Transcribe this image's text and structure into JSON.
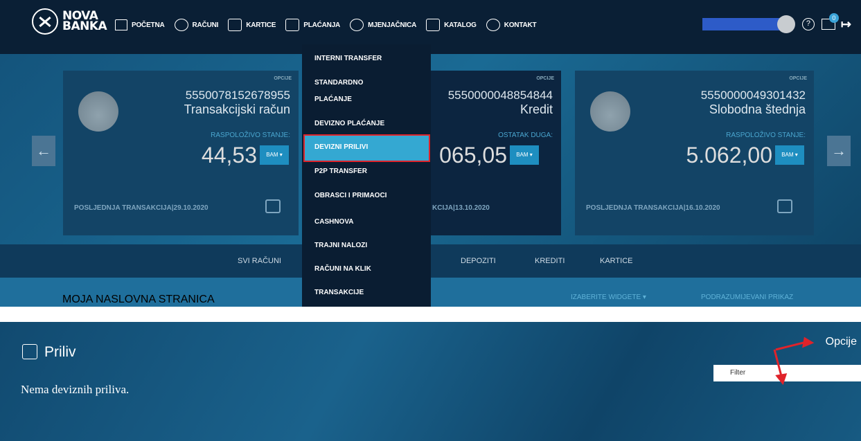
{
  "brand": {
    "line1": "NOVA",
    "line2": "BANKA"
  },
  "nav": {
    "items": [
      {
        "label": "POČETNA",
        "icon": "home-icon"
      },
      {
        "label": "RAČUNI",
        "icon": "accounts-icon"
      },
      {
        "label": "KARTICE",
        "icon": "card-icon"
      },
      {
        "label": "PLAĆANJA",
        "icon": "payments-icon"
      },
      {
        "label": "MJENJAČNICA",
        "icon": "exchange-icon"
      },
      {
        "label": "KATALOG",
        "icon": "catalog-icon"
      },
      {
        "label": "KONTAKT",
        "icon": "chat-icon"
      }
    ],
    "help": "?",
    "mail_badge": "0"
  },
  "dropdown": {
    "items": [
      "INTERNI TRANSFER",
      "STANDARDNO",
      "PLAĆANJE",
      "DEVIZNO PLAĆANJE",
      "DEVIZNI PRILIVI",
      "P2P TRANSFER",
      "OBRASCI I PRIMAOCI",
      "CASHNOVA",
      "TRAJNI NALOZI",
      "RAČUNI NA KLIK",
      "TRANSAKCIJE"
    ],
    "selected": "DEVIZNI PRILIVI"
  },
  "cards": [
    {
      "opc": "OPCIJE",
      "number": "5550078152678955",
      "type": "Transakcijski račun",
      "balance_label": "RASPOLOŽIVO STANJE:",
      "amount": "44,53",
      "currency": "BAM ▾",
      "last_tx": "POSLJEDNJA TRANSAKCIJA|29.10.2020"
    },
    {
      "opc": "OPCIJE",
      "number": "5550000048854844",
      "type": "Kredit",
      "balance_label": "OSTATAK DUGA:",
      "amount": "065,05",
      "currency": "BAM ▾",
      "last_tx": "KCIJA|13.10.2020"
    },
    {
      "opc": "OPCIJE",
      "number": "5550000049301432",
      "type": "Slobodna štednja",
      "balance_label": "RASPOLOŽIVO STANJE:",
      "amount": "5.062,00",
      "currency": "BAM ▾",
      "last_tx": "POSLJEDNJA TRANSAKCIJA|16.10.2020"
    }
  ],
  "tabs": [
    "SVI RAČUNI",
    "DEPOZITI",
    "KREDITI",
    "KARTICE"
  ],
  "subbar": {
    "title": "MOJA NASLOVNA STRANICA",
    "widgets": "IZABERITE WIDGETE ▾",
    "default_view": "PODRAZUMIJEVANI PRIKAZ"
  },
  "section": {
    "title": "Priliv",
    "empty_message": "Nema deviznih priliva.",
    "options_label": "Opcije",
    "filter_label": "Filter"
  },
  "colors": {
    "nav_bg": "#0a1f35",
    "highlight": "#34a8d2",
    "annotation_red": "#e0232a",
    "accent_blue": "#1e8ec0"
  }
}
